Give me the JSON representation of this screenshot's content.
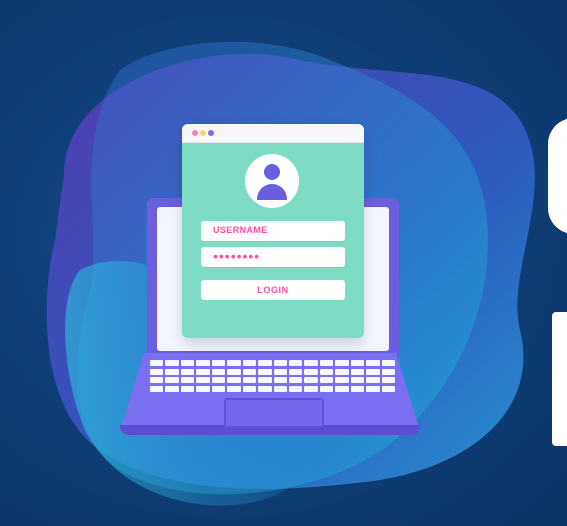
{
  "login": {
    "username_placeholder": "USERNAME",
    "password_placeholder": "••••••••",
    "button_label": "LOGIN"
  },
  "icons": {
    "avatar": "user-avatar-icon",
    "window_controls": [
      "close-dot-icon",
      "minimize-dot-icon",
      "maximize-dot-icon"
    ]
  },
  "colors": {
    "background": "#0f3f7a",
    "card": "#7fdcc4",
    "accent": "#ff4fa3",
    "laptop": "#6b5fe0"
  }
}
